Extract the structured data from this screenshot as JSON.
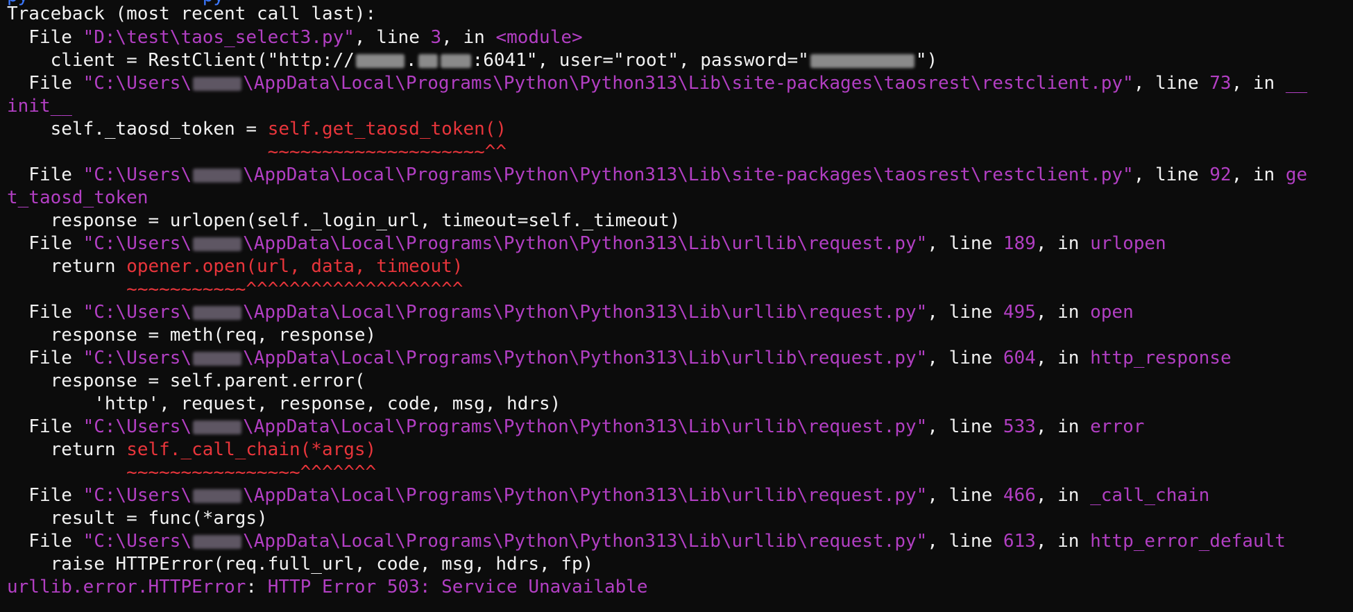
{
  "terminal": {
    "top_fragment": "py                py",
    "traceback_header": "Traceback (most recent call last):",
    "lines": [
      {
        "kind": "file",
        "prefix": "  File ",
        "path": "\"D:\\test\\taos_select3.py\"",
        "mid": ", line ",
        "line": "3",
        "sep": ", in ",
        "func": "<module>"
      },
      {
        "kind": "code",
        "text": "    client = RestClient(\"http://",
        "redacted_a": "",
        "text2": ":6041\", user=\"root\", password=\"",
        "text3": "\")"
      },
      {
        "kind": "file",
        "prefix": "  File ",
        "path_a": "\"C:\\Users\\",
        "path_b": "\\AppData\\Local\\Programs\\Python\\Python313\\Lib\\site-packages\\taosrest\\restclient.py\"",
        "mid": ", line ",
        "line": "73",
        "sep": ", in ",
        "func": "__",
        "func_cont": "init__"
      },
      {
        "kind": "code",
        "text": "    self._taosd_token = ",
        "err": "self.get_taosd_token()"
      },
      {
        "kind": "marker",
        "text": "                        ~~~~~~~~~~~~~~~~~~~~^^"
      },
      {
        "kind": "file",
        "prefix": "  File ",
        "path_a": "\"C:\\Users\\",
        "path_b": "\\AppData\\Local\\Programs\\Python\\Python313\\Lib\\site-packages\\taosrest\\restclient.py\"",
        "mid": ", line ",
        "line": "92",
        "sep": ", in ",
        "func": "ge",
        "func_cont": "t_taosd_token"
      },
      {
        "kind": "code",
        "text": "    response = urlopen(self._login_url, timeout=self._timeout)"
      },
      {
        "kind": "file",
        "prefix": "  File ",
        "path_a": "\"C:\\Users\\",
        "path_b": "\\AppData\\Local\\Programs\\Python\\Python313\\Lib\\urllib\\request.py\"",
        "mid": ", line ",
        "line": "189",
        "sep": ", in ",
        "func": "urlopen"
      },
      {
        "kind": "code",
        "text": "    return ",
        "err": "opener.open(url, data, timeout)"
      },
      {
        "kind": "marker",
        "text": "           ~~~~~~~~~~~^^^^^^^^^^^^^^^^^^^^"
      },
      {
        "kind": "file",
        "prefix": "  File ",
        "path_a": "\"C:\\Users\\",
        "path_b": "\\AppData\\Local\\Programs\\Python\\Python313\\Lib\\urllib\\request.py\"",
        "mid": ", line ",
        "line": "495",
        "sep": ", in ",
        "func": "open"
      },
      {
        "kind": "code",
        "text": "    response = meth(req, response)"
      },
      {
        "kind": "file",
        "prefix": "  File ",
        "path_a": "\"C:\\Users\\",
        "path_b": "\\AppData\\Local\\Programs\\Python\\Python313\\Lib\\urllib\\request.py\"",
        "mid": ", line ",
        "line": "604",
        "sep": ", in ",
        "func": "http_response"
      },
      {
        "kind": "code",
        "text": "    response = self.parent.error("
      },
      {
        "kind": "code",
        "text": "        'http', request, response, code, msg, hdrs)"
      },
      {
        "kind": "file",
        "prefix": "  File ",
        "path_a": "\"C:\\Users\\",
        "path_b": "\\AppData\\Local\\Programs\\Python\\Python313\\Lib\\urllib\\request.py\"",
        "mid": ", line ",
        "line": "533",
        "sep": ", in ",
        "func": "error"
      },
      {
        "kind": "code",
        "text": "    return ",
        "err": "self._call_chain(*args)"
      },
      {
        "kind": "marker",
        "text": "           ~~~~~~~~~~~~~~~~^^^^^^^"
      },
      {
        "kind": "file",
        "prefix": "  File ",
        "path_a": "\"C:\\Users\\",
        "path_b": "\\AppData\\Local\\Programs\\Python\\Python313\\Lib\\urllib\\request.py\"",
        "mid": ", line ",
        "line": "466",
        "sep": ", in ",
        "func": "_call_chain"
      },
      {
        "kind": "code",
        "text": "    result = func(*args)"
      },
      {
        "kind": "file",
        "prefix": "  File ",
        "path_a": "\"C:\\Users\\",
        "path_b": "\\AppData\\Local\\Programs\\Python\\Python313\\Lib\\urllib\\request.py\"",
        "mid": ", line ",
        "line": "613",
        "sep": ", in ",
        "func": "http_error_default"
      },
      {
        "kind": "code",
        "text": "    raise HTTPError(req.full_url, code, msg, hdrs, fp)"
      }
    ],
    "exception_type": "urllib.error.HTTPError",
    "exception_sep": ": ",
    "exception_message": "HTTP Error 503: Service Unavailable",
    "colors": {
      "background": "#0c0c0c",
      "text": "#f2f2f2",
      "path": "#b23fc3",
      "error": "#e8353b"
    }
  }
}
